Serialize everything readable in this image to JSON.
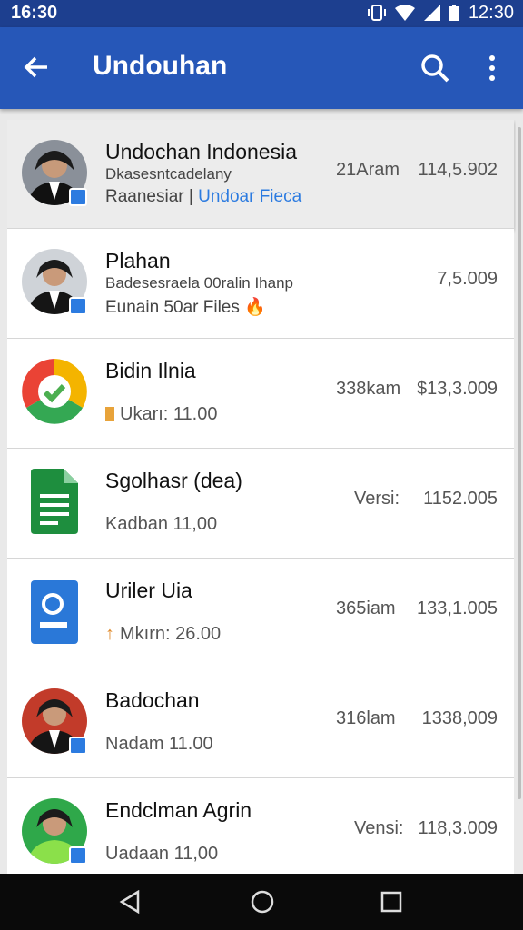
{
  "status_bar": {
    "time_left": "16:30",
    "time_right": "12:30"
  },
  "app_bar": {
    "title": "Undouhan"
  },
  "colors": {
    "app_bar": "#2657b8",
    "status_bar": "#1d3f8f",
    "link": "#2c7be0",
    "nav_bar": "#0a0a0a"
  },
  "items": [
    {
      "name": "Undochan Indonesia",
      "sub1": "Dkasesntcadelany",
      "sub2_prefix": "Raanesiar | ",
      "sub2_link": "Undoar Fieca",
      "mid": "21Aram",
      "value": "114,5.902",
      "icon": "profile-photo-icon"
    },
    {
      "name": "Plahan",
      "sub1": "Badesesraela 00ralin Ihanp",
      "sub2": "Eunain 50ar Files",
      "value": "7,5.009",
      "icon": "profile-photo-icon"
    },
    {
      "name": "Bidin Ilnia",
      "sub": "Ukarı: 11.00",
      "mid": "338kam",
      "value": "$13,3.009",
      "icon": "chrome-icon"
    },
    {
      "name": "Sgolhasr (dea)",
      "sub": "Kadban 11,00",
      "mid": "Versi:",
      "value": "1152.005",
      "icon": "sheets-icon"
    },
    {
      "name": "Uriler Uia",
      "sub": "Mkırn: 26.00",
      "mid": "365iam",
      "value": "133,1.005",
      "icon": "docs-icon"
    },
    {
      "name": "Badochan",
      "sub": "Nadam 11.00",
      "mid": "316lam",
      "value": "1338,009",
      "icon": "profile-photo-icon"
    },
    {
      "name": "Endclman Agrin",
      "sub": "Uadaan 11,00",
      "mid": "Vensi:",
      "value": "118,3.009",
      "icon": "profile-photo-icon"
    }
  ]
}
